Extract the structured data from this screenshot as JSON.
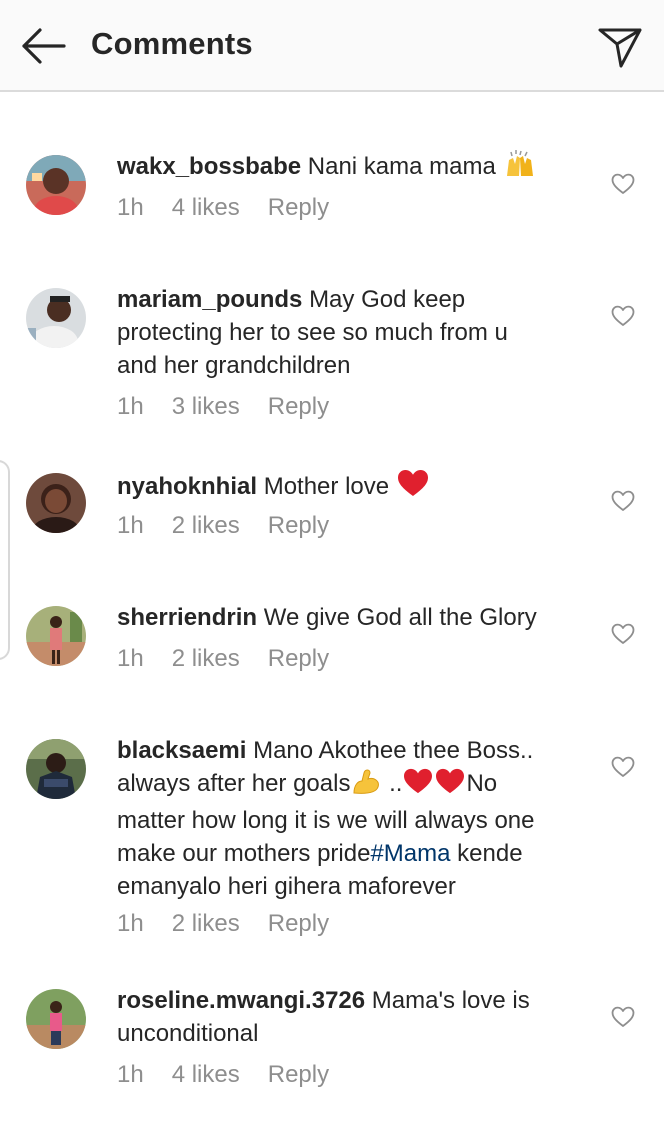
{
  "header": {
    "title": "Comments"
  },
  "comments": [
    {
      "username": "wakx_bossbabe",
      "text": "Nani kama mama",
      "time": "1h",
      "likes": "4 likes",
      "reply": "Reply"
    },
    {
      "username": "mariam_pounds",
      "text_line1": "May God keep",
      "text_line2": "protecting her to see so much from u",
      "text_line3": "and her grandchildren",
      "time": "1h",
      "likes": "3 likes",
      "reply": "Reply"
    },
    {
      "username": "nyahoknhial",
      "text": "Mother love",
      "time": "1h",
      "likes": "2 likes",
      "reply": "Reply"
    },
    {
      "username": "sherriendrin",
      "text": "We give God all the Glory",
      "time": "1h",
      "likes": "2 likes",
      "reply": "Reply"
    },
    {
      "username": "blacksaemi",
      "text_line1": "Mano Akothee thee Boss..",
      "text_line2a": "always after her goals",
      "text_line2b": " ..",
      "text_line2c": "No",
      "text_line3": "matter how long it is we will always one",
      "text_line4a": "make our mothers pride",
      "hashtag": "#Mama",
      "text_line4b": " kende",
      "text_line5": "emanyalo heri gihera maforever",
      "time": "1h",
      "likes": "2 likes",
      "reply": "Reply"
    },
    {
      "username": "roseline.mwangi.3726",
      "text_line1": "Mama's love is",
      "text_line2": "unconditional",
      "time": "1h",
      "likes": "4 likes",
      "reply": "Reply"
    }
  ],
  "icons": {
    "back": "arrow-left-icon",
    "send": "paper-plane-icon",
    "like": "heart-outline-icon"
  },
  "colors": {
    "text": "#262626",
    "secondary": "#8e8e8e",
    "hashtag": "#003569",
    "header_bg": "#fafafa",
    "heart_emoji": "#e0202e"
  }
}
